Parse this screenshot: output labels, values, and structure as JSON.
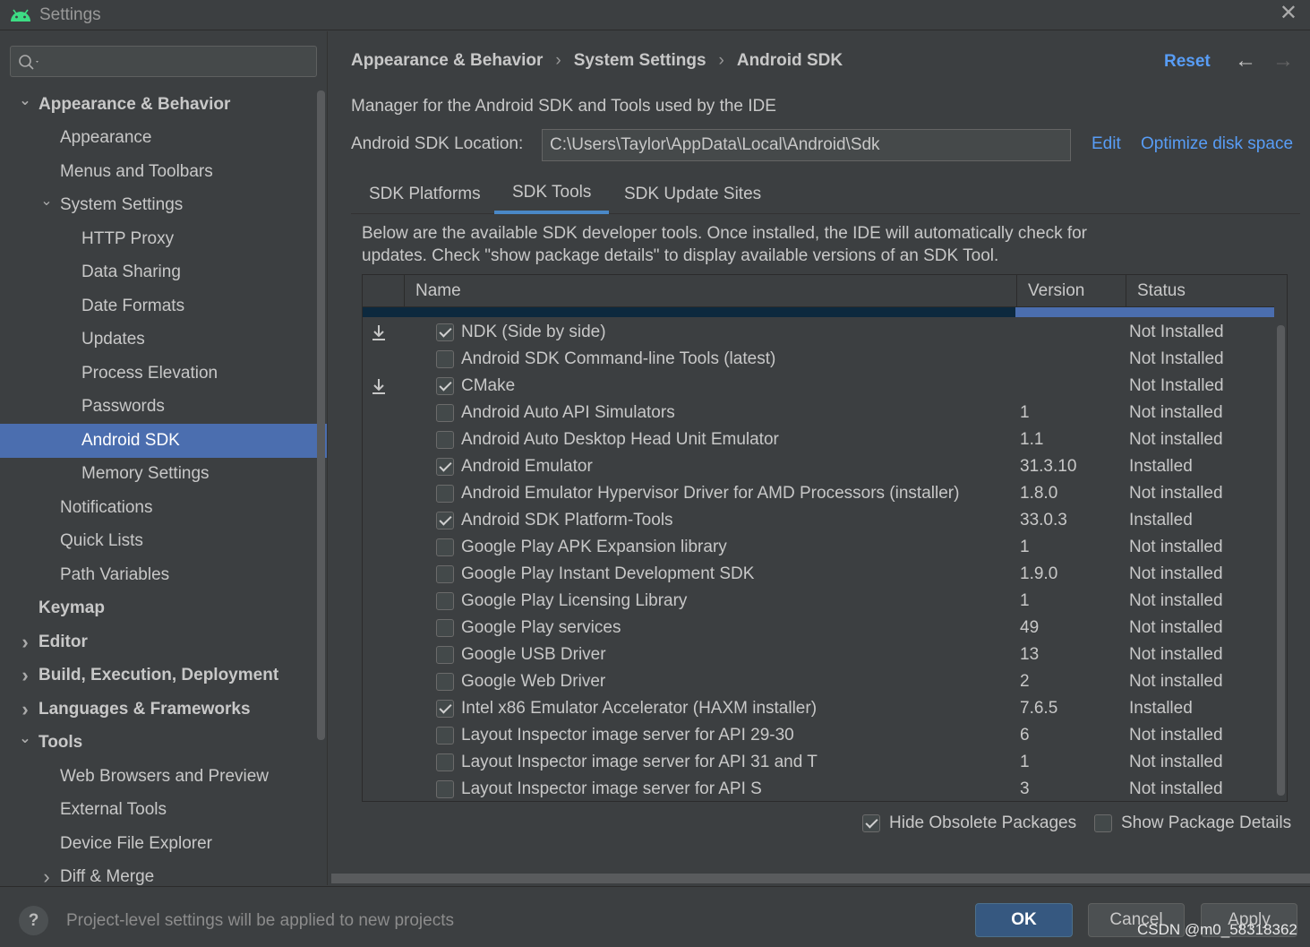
{
  "window": {
    "title": "Settings",
    "close_glyph": "✕",
    "app_icon": "android-icon"
  },
  "sidebar": {
    "search_placeholder": "",
    "items": [
      {
        "label": "Appearance & Behavior",
        "level": 0,
        "bold": true,
        "arrow": "down"
      },
      {
        "label": "Appearance",
        "level": 1
      },
      {
        "label": "Menus and Toolbars",
        "level": 1
      },
      {
        "label": "System Settings",
        "level": 1,
        "arrow": "down"
      },
      {
        "label": "HTTP Proxy",
        "level": 2
      },
      {
        "label": "Data Sharing",
        "level": 2
      },
      {
        "label": "Date Formats",
        "level": 2
      },
      {
        "label": "Updates",
        "level": 2
      },
      {
        "label": "Process Elevation",
        "level": 2
      },
      {
        "label": "Passwords",
        "level": 2
      },
      {
        "label": "Android SDK",
        "level": 2,
        "selected": true
      },
      {
        "label": "Memory Settings",
        "level": 2
      },
      {
        "label": "Notifications",
        "level": 1
      },
      {
        "label": "Quick Lists",
        "level": 1
      },
      {
        "label": "Path Variables",
        "level": 1
      },
      {
        "label": "Keymap",
        "level": 0,
        "bold": true
      },
      {
        "label": "Editor",
        "level": 0,
        "bold": true,
        "arrow": "right"
      },
      {
        "label": "Build, Execution, Deployment",
        "level": 0,
        "bold": true,
        "arrow": "right"
      },
      {
        "label": "Languages & Frameworks",
        "level": 0,
        "bold": true,
        "arrow": "right"
      },
      {
        "label": "Tools",
        "level": 0,
        "bold": true,
        "arrow": "down"
      },
      {
        "label": "Web Browsers and Preview",
        "level": 1
      },
      {
        "label": "External Tools",
        "level": 1
      },
      {
        "label": "Device File Explorer",
        "level": 1
      },
      {
        "label": "Diff & Merge",
        "level": 1,
        "arrow": "right"
      }
    ]
  },
  "header": {
    "breadcrumb": [
      "Appearance & Behavior",
      "System Settings",
      "Android SDK"
    ],
    "breadcrumb_sep": "›",
    "reset_label": "Reset",
    "back_glyph": "←",
    "forward_glyph": "→"
  },
  "main": {
    "description": "Manager for the Android SDK and Tools used by the IDE",
    "location_label": "Android SDK Location:",
    "location_value": "C:\\Users\\Taylor\\AppData\\Local\\Android\\Sdk",
    "edit_label": "Edit",
    "optimize_label": "Optimize disk space",
    "tabs": [
      {
        "label": "SDK Platforms",
        "active": false
      },
      {
        "label": "SDK Tools",
        "active": true
      },
      {
        "label": "SDK Update Sites",
        "active": false
      }
    ],
    "info_text": "Below are the available SDK developer tools. Once installed, the IDE will automatically check for updates. Check \"show package details\" to display available versions of an SDK Tool."
  },
  "table": {
    "columns": [
      "Name",
      "Version",
      "Status"
    ],
    "rows": [
      {
        "name": "NDK (Side by side)",
        "version": "",
        "status": "Not Installed",
        "checked": true,
        "download": true
      },
      {
        "name": "Android SDK Command-line Tools (latest)",
        "version": "",
        "status": "Not Installed",
        "checked": false,
        "download": false
      },
      {
        "name": "CMake",
        "version": "",
        "status": "Not Installed",
        "checked": true,
        "download": true
      },
      {
        "name": "Android Auto API Simulators",
        "version": "1",
        "status": "Not installed",
        "checked": false,
        "download": false
      },
      {
        "name": "Android Auto Desktop Head Unit Emulator",
        "version": "1.1",
        "status": "Not installed",
        "checked": false,
        "download": false
      },
      {
        "name": "Android Emulator",
        "version": "31.3.10",
        "status": "Installed",
        "checked": true,
        "download": false
      },
      {
        "name": "Android Emulator Hypervisor Driver for AMD Processors (installer)",
        "version": "1.8.0",
        "status": "Not installed",
        "checked": false,
        "download": false
      },
      {
        "name": "Android SDK Platform-Tools",
        "version": "33.0.3",
        "status": "Installed",
        "checked": true,
        "download": false
      },
      {
        "name": "Google Play APK Expansion library",
        "version": "1",
        "status": "Not installed",
        "checked": false,
        "download": false
      },
      {
        "name": "Google Play Instant Development SDK",
        "version": "1.9.0",
        "status": "Not installed",
        "checked": false,
        "download": false
      },
      {
        "name": "Google Play Licensing Library",
        "version": "1",
        "status": "Not installed",
        "checked": false,
        "download": false
      },
      {
        "name": "Google Play services",
        "version": "49",
        "status": "Not installed",
        "checked": false,
        "download": false
      },
      {
        "name": "Google USB Driver",
        "version": "13",
        "status": "Not installed",
        "checked": false,
        "download": false
      },
      {
        "name": "Google Web Driver",
        "version": "2",
        "status": "Not installed",
        "checked": false,
        "download": false
      },
      {
        "name": "Intel x86 Emulator Accelerator (HAXM installer)",
        "version": "7.6.5",
        "status": "Installed",
        "checked": true,
        "download": false
      },
      {
        "name": "Layout Inspector image server for API 29-30",
        "version": "6",
        "status": "Not installed",
        "checked": false,
        "download": false
      },
      {
        "name": "Layout Inspector image server for API 31 and T",
        "version": "1",
        "status": "Not installed",
        "checked": false,
        "download": false
      },
      {
        "name": "Layout Inspector image server for API S",
        "version": "3",
        "status": "Not installed",
        "checked": false,
        "download": false
      }
    ]
  },
  "options": {
    "hide_obsolete_label": "Hide Obsolete Packages",
    "hide_obsolete_checked": true,
    "show_details_label": "Show Package Details",
    "show_details_checked": false
  },
  "footer": {
    "help_glyph": "?",
    "hint": "Project-level settings will be applied to new projects",
    "ok_label": "OK",
    "cancel_label": "Cancel",
    "apply_label": "Apply",
    "watermark": "CSDN @m0_58318362"
  },
  "colors": {
    "accent": "#4b6eaf",
    "link": "#589df6",
    "background": "#3c3f41"
  }
}
